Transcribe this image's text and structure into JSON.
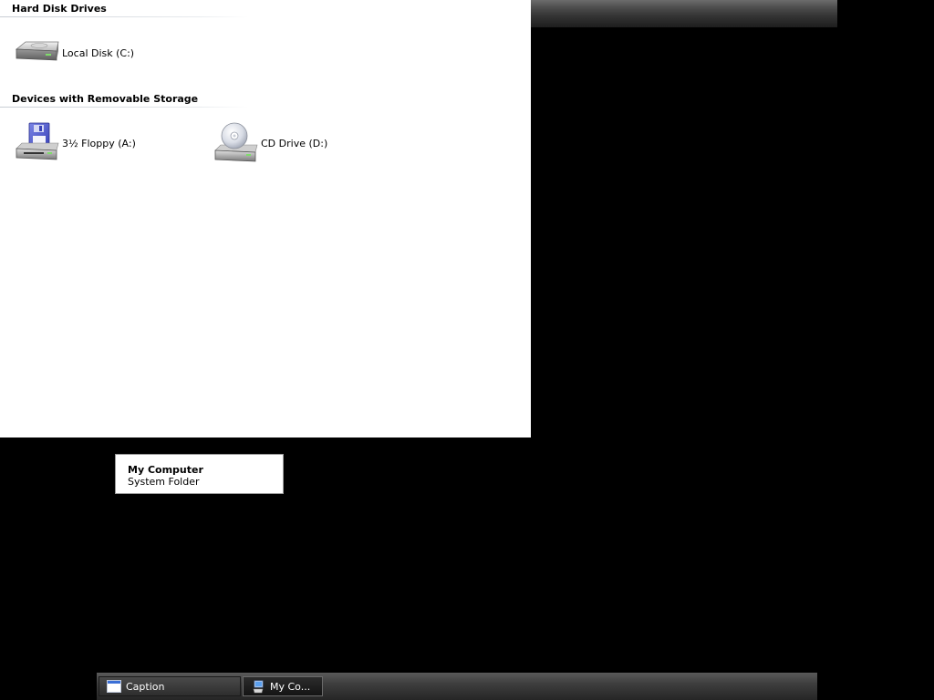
{
  "explorer": {
    "groups": [
      {
        "header": "Hard Disk Drives",
        "items": [
          {
            "label": "Local Disk (C:)",
            "icon": "hard-disk-icon"
          }
        ]
      },
      {
        "header": "Devices with Removable Storage",
        "items": [
          {
            "label": "3½ Floppy (A:)",
            "icon": "floppy-drive-icon"
          },
          {
            "label": "CD Drive (D:)",
            "icon": "cd-drive-icon"
          }
        ]
      }
    ]
  },
  "tooltip": {
    "title": "My Computer",
    "subtitle": "System Folder"
  },
  "taskbar": {
    "tasks": [
      {
        "label": "Caption",
        "icon": "window-icon"
      },
      {
        "label": "My Co...",
        "icon": "my-computer-icon"
      }
    ]
  }
}
